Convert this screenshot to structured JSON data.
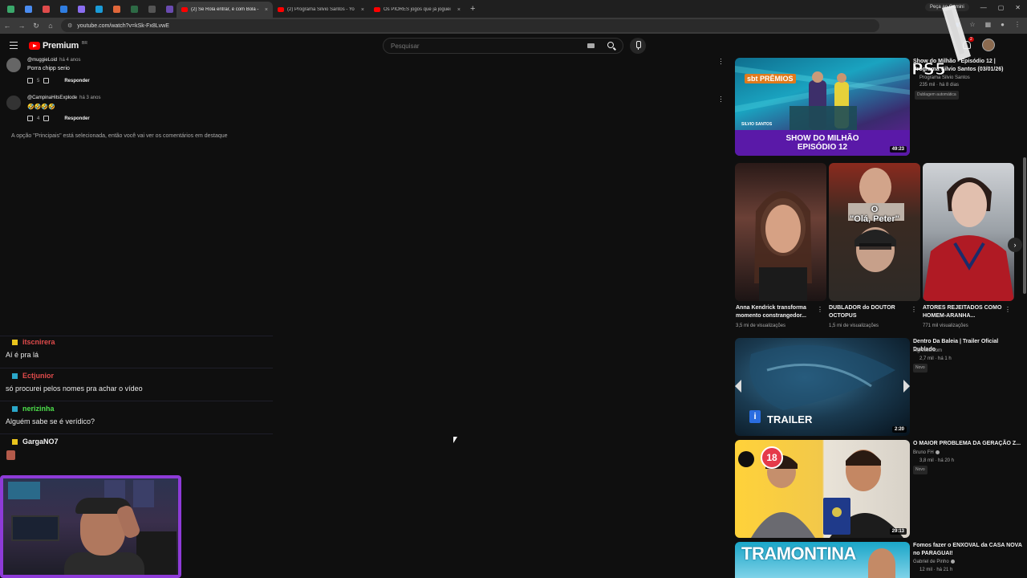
{
  "browser": {
    "tabs": [
      {
        "title": "(2) Se Rola entrar, é com Bola -",
        "active": true
      },
      {
        "title": "(2) Programa Silvio Santos - Yo",
        "active": false
      },
      {
        "title": "Os PIORES jogos que já joguei",
        "active": false
      }
    ],
    "new_tab": "+",
    "gemini_label": "Peça ao Gemini",
    "url": "youtube.com/watch?v=kSk-Fx8LvwE",
    "close_glyph": "×"
  },
  "youtube": {
    "logo_text": "Premium",
    "logo_region": "BR",
    "search_placeholder": "Pesquisar",
    "notif_count": "2"
  },
  "comments": [
    {
      "author": "@muggieLoid",
      "age": "há 4 anos",
      "text": "Porra chipp serio",
      "likes": "5",
      "reply": "Responder"
    },
    {
      "author": "@CampinaHitsExplode",
      "age": "há 3 anos",
      "text": "🤣🤣🤣🤣",
      "likes": "4",
      "reply": "Responder"
    }
  ],
  "comments_note": "A opção \"Principais\" está selecionada, então você vai ver os comentários em destaque",
  "chat": [
    {
      "user": "itscnirera",
      "color": "#e04b4b",
      "icon_color": "#e8c31c",
      "message": "Aí é pra lá"
    },
    {
      "user": "Ectjunior",
      "color": "#e04b4b",
      "icon_color": "#2aa7c9",
      "message": "só procurei pelos nomes pra achar o vídeo"
    },
    {
      "user": "nerizinha",
      "color": "#4de04b",
      "icon_color": "#2aa7c9",
      "message": "Alguém sabe se é verídico?"
    },
    {
      "user": "GargaNO7",
      "color": "#f1f1f1",
      "icon_color": "#e8c31c",
      "message": ""
    }
  ],
  "recommendations": {
    "top": {
      "title_line1": "Show do Milhão - Episódio 12 |",
      "title_line2": "Programa Silvio Santos (03/01/26)",
      "channel": "Programa Silvio Santos",
      "meta": "235 mil · há 8 dias",
      "pill": "Dublagem automática",
      "thumb_text_line1": "SHOW DO MILHÃO",
      "thumb_text_line2": "EPISÓDIO 12",
      "thumb_logo": "sbt PRÊMIOS",
      "thumb_tag": "SILVIO SANTOS",
      "duration": "49:23"
    },
    "shorts": [
      {
        "title": "Anna Kendrick transforma momento constrangedor...",
        "views": "3,5 mi de visualizações"
      },
      {
        "title": "DUBLADOR do DOUTOR OCTOPUS",
        "views": "1,5 mi de visualizações",
        "overlay": "\"Olá, Peter\"",
        "overlay_top": "O"
      },
      {
        "title": "ATORES REJEITADOS COMO HOMEM-ARANHA...",
        "views": "771 mil visualizações"
      }
    ],
    "list": [
      {
        "title": "Dentro Da Baleia | Trailer Oficial Dublado",
        "channel": "Ingresso.com",
        "meta": "2,7 mil · há 1 h",
        "pill": "Novo",
        "duration": "2:20",
        "thumb_text": "TRAILER"
      },
      {
        "title": "O MAIOR PROBLEMA DA GERAÇÃO Z...",
        "channel": "Bruno FH",
        "meta": "3,8 mil · há 20 h",
        "pill": "Novo",
        "duration": "29:13",
        "thumb_text": "18"
      },
      {
        "title": "Fomos fazer o ENXOVAL da CASA NOVA no PARAGUAI!",
        "channel": "Gabriel de Pinho",
        "meta": "12 mil · há 21 h",
        "pill": "",
        "duration": "",
        "thumb_text": "TRAMONTINA"
      }
    ]
  },
  "overlay": {
    "ps5_logo": "PS5"
  }
}
